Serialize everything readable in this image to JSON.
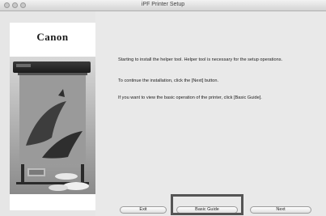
{
  "window": {
    "title": "iPF Printer Setup"
  },
  "sidebar": {
    "logo": "Canon",
    "image_icon": "printer-illustration"
  },
  "content": {
    "paragraph1": "Starting to install the helper tool. Helper tool is necessary for the setup operations.",
    "paragraph2": "To continue the installation, click the [Next] button.",
    "paragraph3": "If you want to view the basic operation of the printer, click [Basic Guide]."
  },
  "buttons": {
    "exit": "Exit",
    "basic_guide": "Basic Guide",
    "next": "Next"
  },
  "colors": {
    "window_bg": "#e6e6e6",
    "highlight": "#555555"
  }
}
